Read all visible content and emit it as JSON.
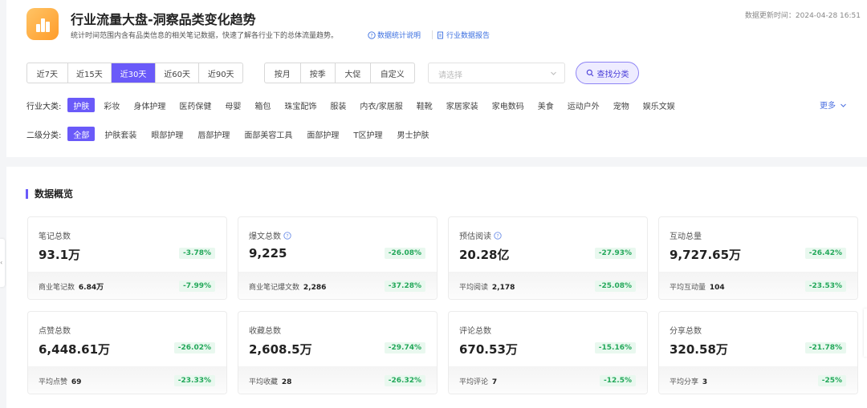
{
  "header": {
    "title": "行业流量大盘-洞察品类变化趋势",
    "description": "统计时间范围内含有品类信息的相关笔记数据，快速了解各行业下的总体流量趋势。",
    "link_stats": "数据统计说明",
    "link_report": "行业数据报告",
    "update_time": "数据更新时间：2024-04-28 16:51"
  },
  "filters": {
    "range_tabs": [
      "近7天",
      "近15天",
      "近30天",
      "近60天",
      "近90天"
    ],
    "range_selected": "近30天",
    "period_tabs": [
      "按月",
      "按季",
      "大促",
      "自定义"
    ],
    "select_placeholder": "请选择",
    "find_button": "查找分类"
  },
  "category": {
    "label": "行业大类:",
    "items": [
      "护肤",
      "彩妆",
      "身体护理",
      "医药保健",
      "母婴",
      "箱包",
      "珠宝配饰",
      "服装",
      "内衣/家居服",
      "鞋靴",
      "家居家装",
      "家电数码",
      "美食",
      "运动户外",
      "宠物",
      "娱乐文娱"
    ],
    "selected": "护肤",
    "more": "更多"
  },
  "subcategory": {
    "label": "二级分类:",
    "items": [
      "全部",
      "护肤套装",
      "眼部护理",
      "唇部护理",
      "面部美容工具",
      "面部护理",
      "T区护理",
      "男士护肤"
    ],
    "selected": "全部"
  },
  "overview": {
    "title": "数据概览",
    "cards": [
      {
        "title": "笔记总数",
        "info": false,
        "value": "93.1万",
        "change": "-3.78%",
        "sub_label": "商业笔记数",
        "sub_value": "6.84万",
        "sub_change": "-7.99%"
      },
      {
        "title": "爆文总数",
        "info": true,
        "value": "9,225",
        "change": "-26.08%",
        "sub_label": "商业笔记爆文数",
        "sub_value": "2,286",
        "sub_change": "-37.28%"
      },
      {
        "title": "预估阅读",
        "info": true,
        "value": "20.28亿",
        "change": "-27.93%",
        "sub_label": "平均阅读",
        "sub_value": "2,178",
        "sub_change": "-25.08%"
      },
      {
        "title": "互动总量",
        "info": false,
        "value": "9,727.65万",
        "change": "-26.42%",
        "sub_label": "平均互动量",
        "sub_value": "104",
        "sub_change": "-23.53%"
      },
      {
        "title": "点赞总数",
        "info": false,
        "value": "6,448.61万",
        "change": "-26.02%",
        "sub_label": "平均点赞",
        "sub_value": "69",
        "sub_change": "-23.33%"
      },
      {
        "title": "收藏总数",
        "info": false,
        "value": "2,608.5万",
        "change": "-29.74%",
        "sub_label": "平均收藏",
        "sub_value": "28",
        "sub_change": "-26.32%"
      },
      {
        "title": "评论总数",
        "info": false,
        "value": "670.53万",
        "change": "-15.16%",
        "sub_label": "平均评论",
        "sub_value": "7",
        "sub_change": "-12.5%"
      },
      {
        "title": "分享总数",
        "info": false,
        "value": "320.58万",
        "change": "-21.78%",
        "sub_label": "平均分享",
        "sub_value": "3",
        "sub_change": "-25%"
      }
    ]
  },
  "colors": {
    "accent": "#6a5af9",
    "positive_badge_text": "#23a85a",
    "positive_badge_bg": "#e9f8ef",
    "link": "#3b6fe0",
    "logo": "#ffa63a"
  },
  "icons": {
    "logo": "bar-chart-icon",
    "info": "question-circle-icon",
    "report": "document-icon",
    "search": "search-icon",
    "select": "chevron-down-icon",
    "more": "chevron-down-icon"
  }
}
